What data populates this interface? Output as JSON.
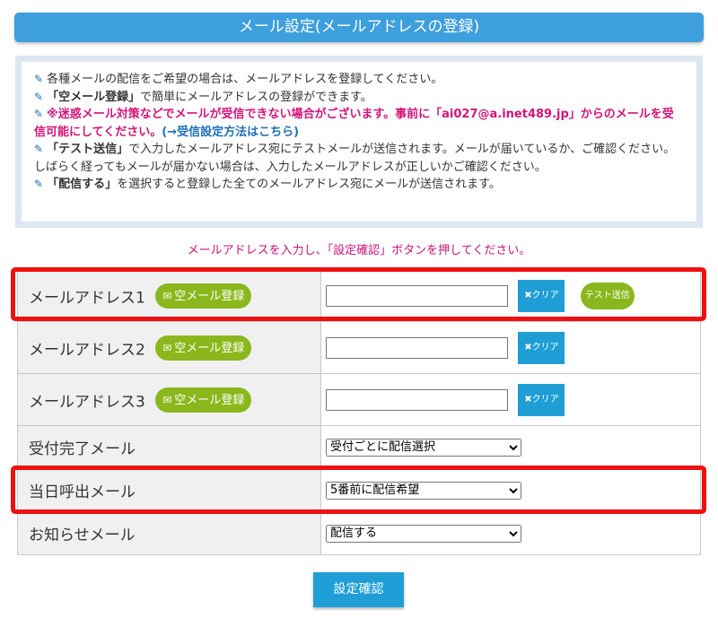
{
  "header": {
    "title": "メール設定(メールアドレスの登録)"
  },
  "notes": {
    "n1": "各種メールの配信をご希望の場合は、メールアドレスを登録してください。",
    "n2_bold": "「空メール登録」",
    "n2_rest": "で簡単にメールアドレスの登録ができます。",
    "n3_red": "※迷惑メール対策などでメールが受信できない場合がございます。事前に「ai027@a.inet489.jp」からのメールを受信可能にしてください。",
    "n3_link": "(→受信設定方法はこちら)",
    "n4_bold": "「テスト送信」",
    "n4_rest": "で入力したメールアドレス宛にテストメールが送信されます。メールが届いているか、ご確認ください。しばらく経ってもメールが届かない場合は、入力したメールアドレスが正しいかご確認ください。",
    "n5_bold": "「配信する」",
    "n5_rest": "を選択すると登録した全てのメールアドレス宛にメールが送信されます。"
  },
  "instruction": "メールアドレスを入力し、「設定確認」ボタンを押してください。",
  "form": {
    "empty_mail_label": "空メール登録",
    "clear_label": "クリア",
    "test_label": "テスト送信",
    "email_rows": [
      {
        "label": "メールアドレス1",
        "value": ""
      },
      {
        "label": "メールアドレス2",
        "value": ""
      },
      {
        "label": "メールアドレス3",
        "value": ""
      }
    ],
    "select_rows": [
      {
        "label": "受付完了メール",
        "selected": "受付ごとに配信選択"
      },
      {
        "label": "当日呼出メール",
        "selected": "5番前に配信希望"
      },
      {
        "label": "お知らせメール",
        "selected": "配信する"
      }
    ]
  },
  "submit_label": "設定確認",
  "colors": {
    "title_bar": "#3d9fdc",
    "green_button": "#8ab81c",
    "blue_button": "#1f9ed6",
    "highlight": "#ee1111",
    "red_text": "#d4147a"
  }
}
